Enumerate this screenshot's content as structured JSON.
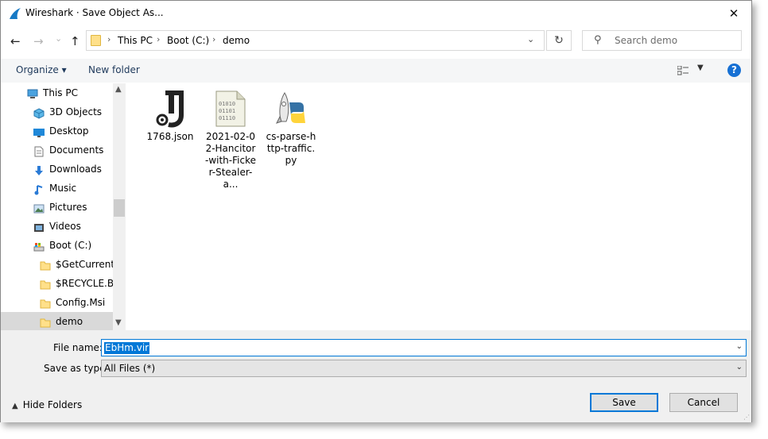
{
  "window": {
    "title": "Wireshark · Save Object As...",
    "close_glyph": "✕"
  },
  "nav": {
    "back": "←",
    "forward": "→",
    "recent": "⌄",
    "up": "↑",
    "breadcrumb": [
      "This PC",
      "Boot (C:)",
      "demo"
    ],
    "refresh": "↻",
    "search_placeholder": "Search demo"
  },
  "toolbar": {
    "organize": "Organize ▾",
    "new_folder": "New folder",
    "help": "?"
  },
  "tree": [
    {
      "label": "This PC",
      "icon": "computer-icon"
    },
    {
      "label": "3D Objects",
      "icon": "3d-objects-icon"
    },
    {
      "label": "Desktop",
      "icon": "desktop-icon"
    },
    {
      "label": "Documents",
      "icon": "documents-icon"
    },
    {
      "label": "Downloads",
      "icon": "downloads-icon"
    },
    {
      "label": "Music",
      "icon": "music-icon"
    },
    {
      "label": "Pictures",
      "icon": "pictures-icon"
    },
    {
      "label": "Videos",
      "icon": "videos-icon"
    },
    {
      "label": "Boot (C:)",
      "icon": "drive-icon"
    },
    {
      "label": "$GetCurrent",
      "icon": "folder-icon"
    },
    {
      "label": "$RECYCLE.BIN",
      "icon": "folder-icon"
    },
    {
      "label": "Config.Msi",
      "icon": "folder-icon"
    },
    {
      "label": "demo",
      "icon": "folder-icon",
      "selected": true
    }
  ],
  "files": [
    {
      "name": "1768.json",
      "icon": "json-file-icon"
    },
    {
      "name": "2021-02-02-Hancitor-with-Ficker-Stealer-a...",
      "icon": "binary-file-icon"
    },
    {
      "name": "cs-parse-http-traffic.py",
      "icon": "python-file-icon"
    }
  ],
  "save": {
    "file_name_label": "File name:",
    "file_name_value": "EbHm.vir",
    "type_label": "Save as type:",
    "type_value": "All Files (*)",
    "hide_folders": "Hide Folders",
    "save_button": "Save",
    "cancel_button": "Cancel"
  },
  "colors": {
    "accent": "#0078d7",
    "link": "#1e395b",
    "selection": "#d9d9d9"
  }
}
